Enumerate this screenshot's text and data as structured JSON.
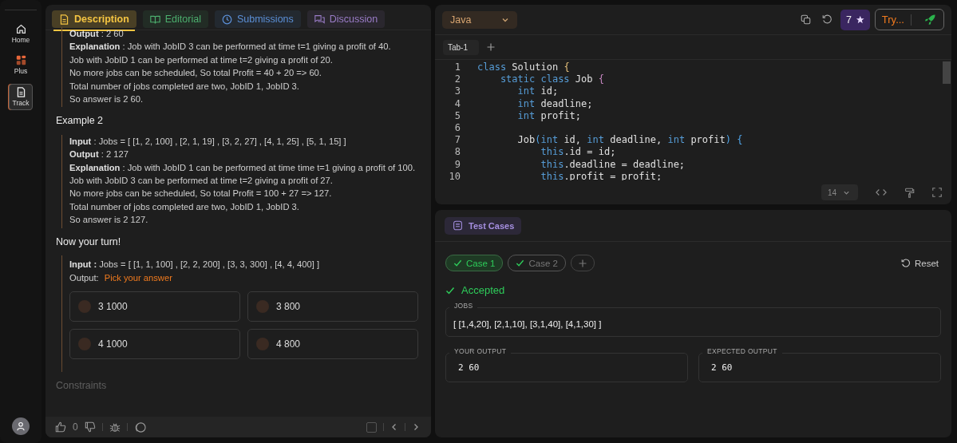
{
  "sidebar": {
    "items": [
      {
        "label": "Home",
        "selected": false
      },
      {
        "label": "Plus",
        "selected": false
      },
      {
        "label": "Track",
        "selected": true
      }
    ]
  },
  "problem_tabs": [
    {
      "label": "Description",
      "selected": true,
      "color": "#f5c542"
    },
    {
      "label": "Editorial",
      "selected": false,
      "color": "#4caf6e"
    },
    {
      "label": "Submissions",
      "selected": false,
      "color": "#5b8fd6"
    },
    {
      "label": "Discussion",
      "selected": false,
      "color": "#9a7cc7"
    }
  ],
  "description": {
    "blocks": [
      {
        "kind": "example",
        "lines": [
          "**Output** : 2 60",
          "**Explanation** : Job with JobID 3 can be performed at time t=1 giving a profit of 40.",
          "Job with JobID 1 can be performed at time t=2 giving a profit of 20.",
          "No more jobs can be scheduled, So total Profit = 40 + 20 => 60.",
          "Total number of jobs completed are two, JobID 1, JobID 3.",
          "So answer is 2 60."
        ]
      },
      {
        "kind": "heading",
        "text": "Example 2"
      },
      {
        "kind": "example",
        "lines": [
          "**Input** : Jobs = [ [1, 2, 100] , [2, 1, 19] , [3, 2, 27] , [4, 1, 25] , [5, 1, 15] ]",
          "**Output** : 2 127",
          "**Explanation** : Job with JobID 1 can be performed at time time t=1 giving a profit of 100.",
          "Job with JobID 3 can be performed at time t=2 giving a profit of 27.",
          "No more jobs can be scheduled, So total Profit = 100 + 27 => 127.",
          "Total number of jobs completed are two, JobID 1, JobID 3.",
          "So answer is 2 127."
        ]
      },
      {
        "kind": "heading",
        "text": "Now your turn!"
      },
      {
        "kind": "quiz",
        "input": "**Input :** Jobs = [ [1, 1, 100] , [2, 2, 200] , [3, 3, 300] , [4, 4, 400] ]",
        "output_label": "Output:",
        "prompt": "Pick your answer",
        "options": [
          {
            "label": "3 1000",
            "selected": false
          },
          {
            "label": "3 800",
            "selected": false
          },
          {
            "label": "4 1000",
            "selected": false
          },
          {
            "label": "4 800",
            "selected": false
          }
        ]
      },
      {
        "kind": "faded",
        "text": "Constraints"
      }
    ]
  },
  "footer": {
    "likes": "0"
  },
  "editor": {
    "language": "Java",
    "coins": "7",
    "try_label": "Try...",
    "tabs": [
      {
        "label": "Tab-1",
        "selected": true
      }
    ],
    "lines": [
      {
        "number": "1",
        "tokens": [
          {
            "text": "class",
            "kind": "keyword"
          },
          {
            "text": " Solution ",
            "kind": "plain"
          },
          {
            "text": "{",
            "kind": "brace1"
          }
        ]
      },
      {
        "number": "2",
        "tokens": [
          {
            "text": "    static class",
            "kind": "keyword"
          },
          {
            "text": " Job ",
            "kind": "plain"
          },
          {
            "text": "{",
            "kind": "brace2"
          }
        ]
      },
      {
        "number": "3",
        "tokens": [
          {
            "text": "       int",
            "kind": "keyword"
          },
          {
            "text": " id;",
            "kind": "plain"
          }
        ]
      },
      {
        "number": "4",
        "tokens": [
          {
            "text": "       int",
            "kind": "keyword"
          },
          {
            "text": " deadline;",
            "kind": "plain"
          }
        ]
      },
      {
        "number": "5",
        "tokens": [
          {
            "text": "       int",
            "kind": "keyword"
          },
          {
            "text": " profit;",
            "kind": "plain"
          }
        ]
      },
      {
        "number": "6"
      },
      {
        "number": "7",
        "tokens": [
          {
            "text": "       Job",
            "kind": "plain"
          },
          {
            "text": "(",
            "kind": "brace3"
          },
          {
            "text": "int",
            "kind": "keyword"
          },
          {
            "text": " id, ",
            "kind": "plain"
          },
          {
            "text": "int",
            "kind": "keyword"
          },
          {
            "text": " deadline, ",
            "kind": "plain"
          },
          {
            "text": "int",
            "kind": "keyword"
          },
          {
            "text": " profit",
            "kind": "plain"
          },
          {
            "text": ") {",
            "kind": "brace3"
          }
        ]
      },
      {
        "number": "8",
        "tokens": [
          {
            "text": "           this",
            "kind": "keyword"
          },
          {
            "text": ".id = id;",
            "kind": "plain"
          }
        ]
      },
      {
        "number": "9",
        "tokens": [
          {
            "text": "           this",
            "kind": "keyword"
          },
          {
            "text": ".deadline = deadline;",
            "kind": "plain"
          }
        ]
      },
      {
        "number": "10",
        "tokens": [
          {
            "text": "           this",
            "kind": "keyword"
          },
          {
            "text": ".profit = profit;",
            "kind": "plain"
          }
        ]
      }
    ],
    "font_size": "14"
  },
  "test_panel": {
    "title": "Test Cases",
    "reset_label": "Reset",
    "cases": [
      {
        "label": "Case 1",
        "selected": true,
        "passed": true
      },
      {
        "label": "Case 2",
        "selected": false,
        "passed": true
      }
    ],
    "verdict": "Accepted",
    "input": {
      "label": "JOBS",
      "value": "[ [1,4,20], [2,1,10], [3,1,40], [4,1,30] ]"
    },
    "your_output": {
      "label": "YOUR OUTPUT",
      "value": "2 60"
    },
    "expected_output": {
      "label": "EXPECTED OUTPUT",
      "value": "2 60"
    }
  }
}
